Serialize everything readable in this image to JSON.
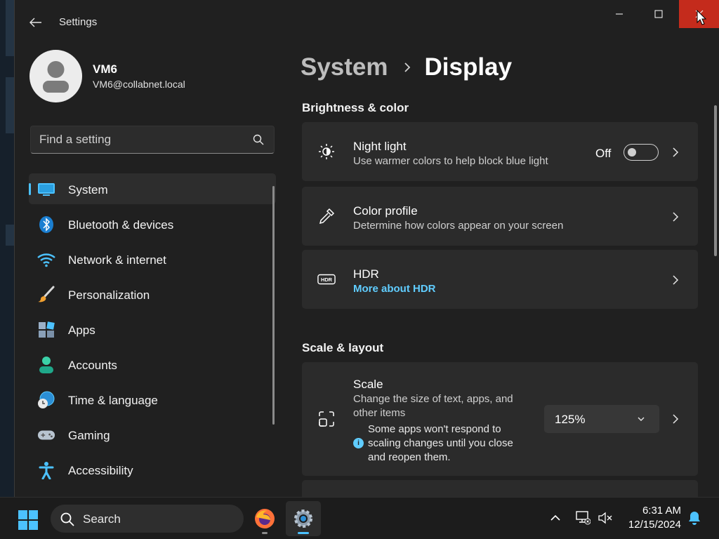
{
  "window": {
    "app_title": "Settings",
    "controls": {
      "minimize": "minimize",
      "maximize": "maximize",
      "close": "close"
    }
  },
  "user": {
    "name": "VM6",
    "email": "VM6@collabnet.local"
  },
  "sidebar": {
    "search_placeholder": "Find a setting",
    "items": [
      {
        "label": "System",
        "icon": "monitor-icon",
        "active": true
      },
      {
        "label": "Bluetooth & devices",
        "icon": "bluetooth-icon"
      },
      {
        "label": "Network & internet",
        "icon": "wifi-icon"
      },
      {
        "label": "Personalization",
        "icon": "brush-icon"
      },
      {
        "label": "Apps",
        "icon": "apps-icon"
      },
      {
        "label": "Accounts",
        "icon": "person-icon"
      },
      {
        "label": "Time & language",
        "icon": "globe-clock-icon"
      },
      {
        "label": "Gaming",
        "icon": "gamepad-icon"
      },
      {
        "label": "Accessibility",
        "icon": "accessibility-icon"
      }
    ]
  },
  "main": {
    "breadcrumb": {
      "parent": "System",
      "current": "Display"
    },
    "sections": {
      "brightness": "Brightness & color",
      "scale_layout": "Scale & layout"
    },
    "cards": {
      "night_light": {
        "title": "Night light",
        "subtitle": "Use warmer colors to help block blue light",
        "toggle_label": "Off",
        "toggle_on": false
      },
      "color_profile": {
        "title": "Color profile",
        "subtitle": "Determine how colors appear on your screen"
      },
      "hdr": {
        "title": "HDR",
        "link": "More about HDR"
      },
      "scale": {
        "title": "Scale",
        "subtitle": "Change the size of text, apps, and other items",
        "info": "Some apps won't respond to scaling changes until you close and reopen them.",
        "value": "125%"
      }
    }
  },
  "taskbar": {
    "search_label": "Search",
    "apps": [
      "firefox-icon",
      "settings-gear-icon"
    ],
    "clock": {
      "time": "6:31 AM",
      "date": "12/15/2024"
    }
  },
  "colors": {
    "accent": "#4cc2ff",
    "link": "#60cdff",
    "close_hover": "#c42b1c",
    "window_bg": "#202020",
    "card_bg": "#2b2b2b"
  }
}
